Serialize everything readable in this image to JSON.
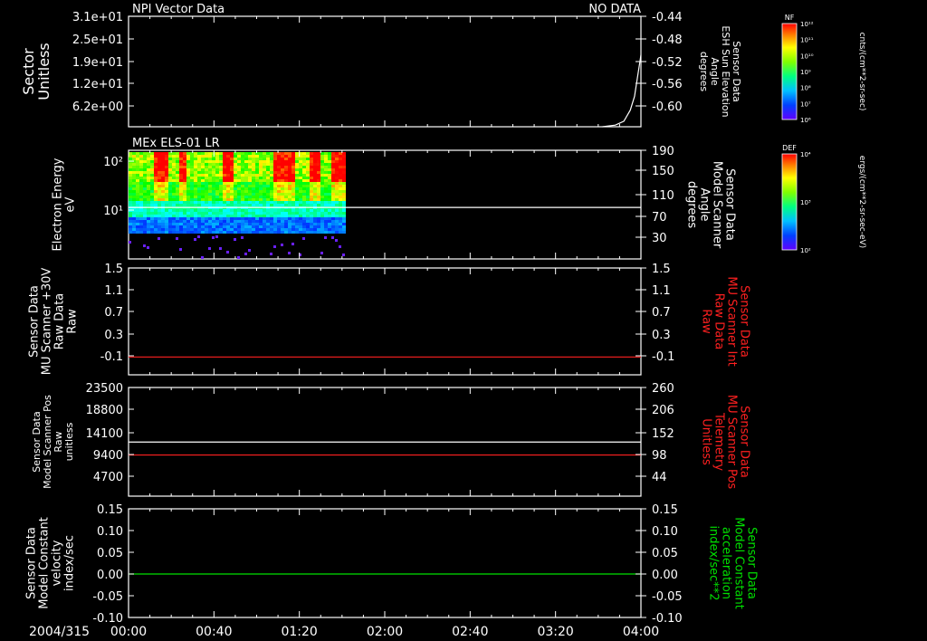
{
  "colors": {
    "background": "#000000",
    "frame": "#ffffff",
    "red_trace": "#ff2020",
    "green_trace": "#00e000",
    "white_trace": "#ffffff"
  },
  "x_axis": {
    "date_label": "2004/315",
    "ticks": [
      "00:00",
      "00:40",
      "01:20",
      "02:00",
      "02:40",
      "03:20",
      "04:00"
    ]
  },
  "chart_data": [
    {
      "type": "line",
      "panel": "npi",
      "title_left": "NPI Vector Data",
      "title_right": "NO DATA",
      "ylabel_left": [
        "Sector",
        "Unitless"
      ],
      "yticks_left": [
        "3.1e+01",
        "2.5e+01",
        "1.9e+01",
        "1.2e+01",
        "6.2e+00"
      ],
      "ylim_left": [
        0,
        31
      ],
      "ylabel_right": [
        "Sensor Data",
        "ESH Sun Elevation",
        "Angle",
        "degrees"
      ],
      "yticks_right": [
        "-0.44",
        "-0.48",
        "-0.52",
        "-0.56",
        "-0.60"
      ],
      "ylim_right": [
        -0.64,
        -0.44
      ],
      "series": [
        {
          "axis": "right",
          "color": "#ffffff",
          "x": [
            "03:42",
            "03:48",
            "03:52",
            "03:55",
            "03:57",
            "03:58",
            "03:59",
            "04:00"
          ],
          "values": [
            -0.64,
            -0.637,
            -0.63,
            -0.61,
            -0.585,
            -0.56,
            -0.535,
            -0.51
          ]
        }
      ]
    },
    {
      "type": "heatmap",
      "panel": "els",
      "title_left": "MEx ELS-01 LR",
      "ylabel_left": [
        "Electron Energy",
        "eV"
      ],
      "yticks_left": [
        "10²",
        "10¹"
      ],
      "ylabel_right": [
        "Sensor Data",
        "Model Scanner",
        "Angle",
        "degrees"
      ],
      "yticks_right": [
        "190",
        "150",
        "110",
        "70",
        "30"
      ],
      "ylim_right": [
        0,
        190
      ],
      "data_extent_x": [
        "00:00",
        "01:43"
      ],
      "series": [
        {
          "axis": "right",
          "color": "#ffffff",
          "values": [
            90
          ]
        }
      ]
    },
    {
      "type": "line",
      "panel": "mu30",
      "ylabel_left": [
        "Sensor Data",
        "MU Scanner +30V",
        "Raw Data",
        "Raw"
      ],
      "yticks_left": [
        "1.5",
        "1.1",
        "0.7",
        "0.3",
        "-0.1"
      ],
      "ylim_left": [
        -0.3,
        1.5
      ],
      "ylabel_right": [
        "Sensor Data",
        "MU Scanner Int",
        "Raw Data",
        "Raw"
      ],
      "yticks_right": [
        "1.5",
        "1.1",
        "0.7",
        "0.3",
        "-0.1"
      ],
      "ylim_right": [
        -0.3,
        1.5
      ],
      "series": [
        {
          "axis": "left",
          "color": "#ff2020",
          "values": [
            0.0
          ]
        }
      ]
    },
    {
      "type": "line",
      "panel": "mupos",
      "ylabel_left": [
        "Sensor Data",
        "Model Scanner Pos",
        "Raw",
        "unitless"
      ],
      "yticks_left": [
        "23500",
        "18800",
        "14100",
        "9400",
        "4700"
      ],
      "ylim_left": [
        0,
        23500
      ],
      "ylabel_right": [
        "Sensor Data",
        "MU Scanner Pos",
        "Telemetry",
        "Unitless"
      ],
      "yticks_right": [
        "260",
        "206",
        "152",
        "98",
        "44"
      ],
      "ylim_right": [
        0,
        260
      ],
      "series": [
        {
          "axis": "left",
          "color": "#ffffff",
          "values": [
            11700
          ]
        },
        {
          "axis": "left",
          "color": "#ff2020",
          "values": [
            8900
          ]
        }
      ]
    },
    {
      "type": "line",
      "panel": "model",
      "ylabel_left": [
        "Sensor Data",
        "Model Constant",
        "velocity",
        "index/sec"
      ],
      "yticks_left": [
        "0.15",
        "0.10",
        "0.05",
        "0.00",
        "-0.05",
        "-0.10"
      ],
      "ylim_left": [
        -0.1,
        0.15
      ],
      "ylabel_right": [
        "Sensor Data",
        "Model Constant",
        "acceleration",
        "index/sec**2"
      ],
      "yticks_right": [
        "0.15",
        "0.10",
        "0.05",
        "0.00",
        "-0.05",
        "-0.10"
      ],
      "ylim_right": [
        -0.1,
        0.15
      ],
      "series": [
        {
          "axis": "left",
          "color": "#00e000",
          "values": [
            0.0
          ]
        }
      ]
    }
  ],
  "colorbars": [
    {
      "name": "nf",
      "top_label": "NF",
      "tick_labels": [
        "10¹²",
        "10¹¹",
        "10¹⁰",
        "10⁹",
        "10⁸",
        "10⁷",
        "10⁶"
      ],
      "unit": "cnts/(cm**2-sr-sec)"
    },
    {
      "name": "def",
      "top_label": "DEF",
      "tick_labels": [
        "10⁴",
        "10³",
        "10²"
      ],
      "unit": "ergs/(cm**2-sr-sec-eV)"
    }
  ]
}
